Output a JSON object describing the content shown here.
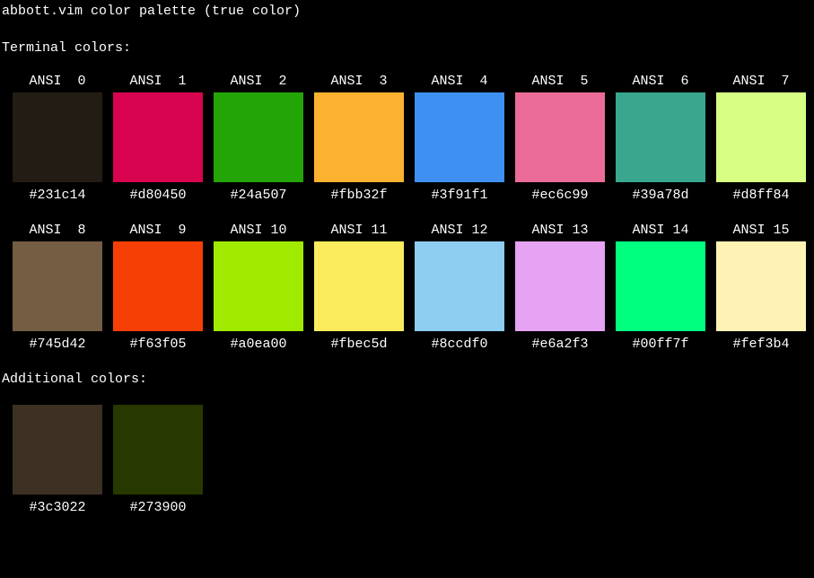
{
  "title": "abbott.vim color palette (true color)",
  "sections": {
    "terminal": {
      "label": "Terminal colors:",
      "rows": [
        [
          {
            "top": "ANSI  0",
            "hex": "#231c14",
            "color": "#231c14"
          },
          {
            "top": "ANSI  1",
            "hex": "#d80450",
            "color": "#d80450"
          },
          {
            "top": "ANSI  2",
            "hex": "#24a507",
            "color": "#24a507"
          },
          {
            "top": "ANSI  3",
            "hex": "#fbb32f",
            "color": "#fbb32f"
          },
          {
            "top": "ANSI  4",
            "hex": "#3f91f1",
            "color": "#3f91f1"
          },
          {
            "top": "ANSI  5",
            "hex": "#ec6c99",
            "color": "#ec6c99"
          },
          {
            "top": "ANSI  6",
            "hex": "#39a78d",
            "color": "#39a78d"
          },
          {
            "top": "ANSI  7",
            "hex": "#d8ff84",
            "color": "#d8ff84"
          }
        ],
        [
          {
            "top": "ANSI  8",
            "hex": "#745d42",
            "color": "#745d42"
          },
          {
            "top": "ANSI  9",
            "hex": "#f63f05",
            "color": "#f63f05"
          },
          {
            "top": "ANSI 10",
            "hex": "#a0ea00",
            "color": "#a0ea00"
          },
          {
            "top": "ANSI 11",
            "hex": "#fbec5d",
            "color": "#fbec5d"
          },
          {
            "top": "ANSI 12",
            "hex": "#8ccdf0",
            "color": "#8ccdf0"
          },
          {
            "top": "ANSI 13",
            "hex": "#e6a2f3",
            "color": "#e6a2f3"
          },
          {
            "top": "ANSI 14",
            "hex": "#00ff7f",
            "color": "#00ff7f"
          },
          {
            "top": "ANSI 15",
            "hex": "#fef3b4",
            "color": "#fef3b4"
          }
        ]
      ]
    },
    "additional": {
      "label": "Additional colors:",
      "rows": [
        [
          {
            "top": "",
            "hex": "#3c3022",
            "color": "#3c3022"
          },
          {
            "top": "",
            "hex": "#273900",
            "color": "#273900"
          }
        ]
      ]
    }
  }
}
